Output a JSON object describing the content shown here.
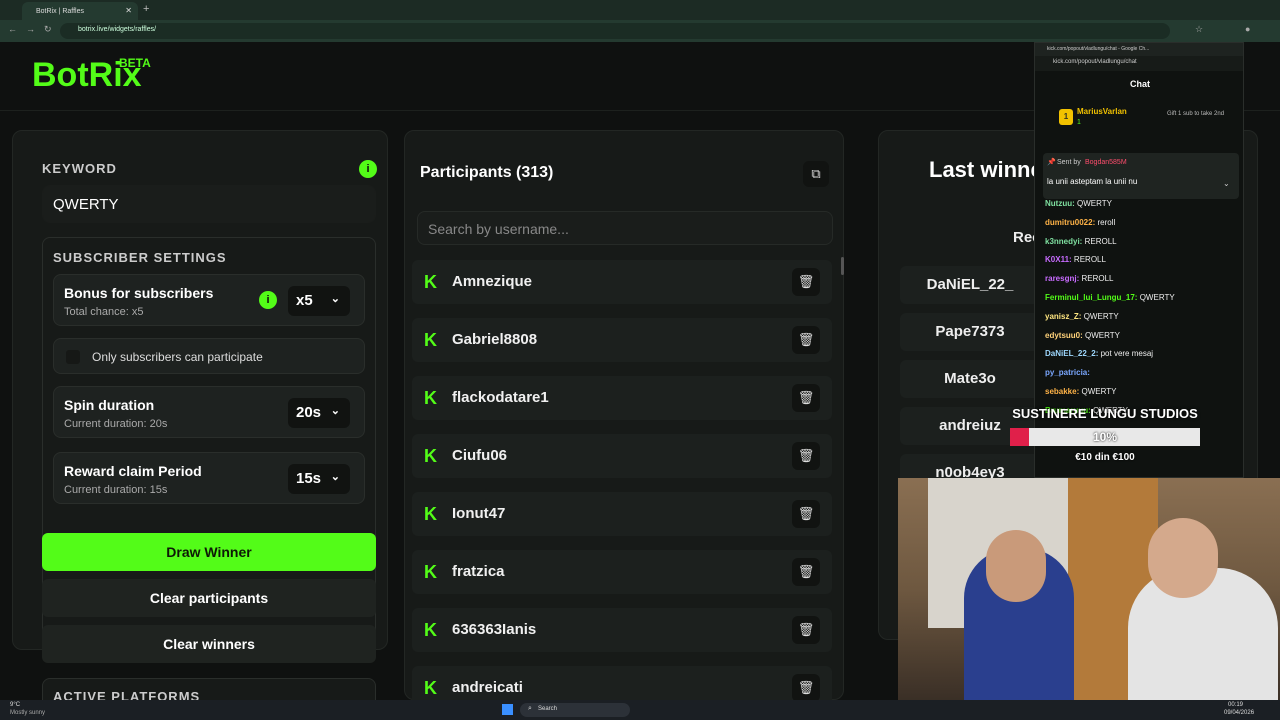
{
  "browser": {
    "tab_title": "BotRix | Raffles",
    "url": "botrix.live/widgets/raffles/"
  },
  "brand": {
    "logo": "BotRix",
    "badge": "BETA"
  },
  "settings": {
    "keyword_label": "KEYWORD",
    "keyword_value": "QWERTY",
    "subscriber_header": "SUBSCRIBER SETTINGS",
    "bonus_title": "Bonus for subscribers",
    "bonus_sub": "Total chance: x5",
    "bonus_value": "x5",
    "only_subs_label": "Only subscribers can participate",
    "only_subs_checked": false,
    "spin_title": "Spin duration",
    "spin_sub": "Current duration: 20s",
    "spin_value": "20s",
    "reward_title": "Reward claim Period",
    "reward_sub": "Current duration: 15s",
    "reward_value": "15s",
    "draw_label": "Draw Winner",
    "clear_participants_label": "Clear participants",
    "clear_winners_label": "Clear winners",
    "platforms_header": "ACTIVE PLATFORMS"
  },
  "participants": {
    "title": "Participants (313)",
    "search_placeholder": "Search by username...",
    "items": [
      {
        "name": "Amnezique"
      },
      {
        "name": "Gabriel8808"
      },
      {
        "name": "flackodatare1"
      },
      {
        "name": "Ciufu06"
      },
      {
        "name": "Ionut47"
      },
      {
        "name": "fratzica"
      },
      {
        "name": "636363Ianis"
      },
      {
        "name": "andreicati"
      }
    ]
  },
  "winners": {
    "title": "Last winne",
    "col_header": "Rec",
    "items": [
      {
        "name": "DaNiEL_22_"
      },
      {
        "name": "Pape7373"
      },
      {
        "name": "Mate3o"
      },
      {
        "name": "andreiuz"
      },
      {
        "name": "n0ob4ey3"
      }
    ]
  },
  "chat": {
    "window_title": "kick.com/popout/vladlungu/chat - Google Ch...",
    "url": "kick.com/popout/vladlungu/chat",
    "header": "Chat",
    "top_gifter": "MariusVarlan",
    "top_gifter_count": "1",
    "gift_prompt": "Gift 1 sub to take 2nd",
    "pinned_by_label": "Sent by",
    "pinned_by_user": "Bogdan585M",
    "pinned_text": "la unii asteptam la unii nu",
    "messages": [
      {
        "user": "Nutzuu:",
        "text": "QWERTY",
        "color": "#7fe0a0"
      },
      {
        "user": "dumitru0022:",
        "text": "reroll",
        "color": "#ffb347"
      },
      {
        "user": "k3nnedyi:",
        "text": "REROLL",
        "color": "#7fe0a0"
      },
      {
        "user": "K0X11:",
        "text": "REROLL",
        "color": "#c86bff"
      },
      {
        "user": "raresgnj:",
        "text": "REROLL",
        "color": "#c86bff"
      },
      {
        "user": "Ferminul_lui_Lungu_17:",
        "text": "QWERTY",
        "color": "#53fc18"
      },
      {
        "user": "yanisz_Z:",
        "text": "QWERTY",
        "color": "#ffe680"
      },
      {
        "user": "edytsuu0:",
        "text": "QWERTY",
        "color": "#ffd27a"
      },
      {
        "user": "DaNiEL_22_2:",
        "text": "pot vere mesaj",
        "color": "#9fd9ff"
      },
      {
        "user": "py_patricia:",
        "text": "",
        "color": "#7aa7ff"
      },
      {
        "user": "sebakke:",
        "text": "QWERTY",
        "color": "#ffb347"
      },
      {
        "user": "Brumaruuu:",
        "text": "QWERTY",
        "color": "#53fc18"
      }
    ]
  },
  "overlay": {
    "title": "SUSTINERE LUNGU STUDIOS",
    "percent": "10%",
    "progress": 0.1,
    "amount": "€10 din €100"
  },
  "taskbar": {
    "weather_temp": "9°C",
    "weather_desc": "Mostly sunny",
    "search": "Search",
    "time": "00:19",
    "date": "09/04/2026"
  }
}
